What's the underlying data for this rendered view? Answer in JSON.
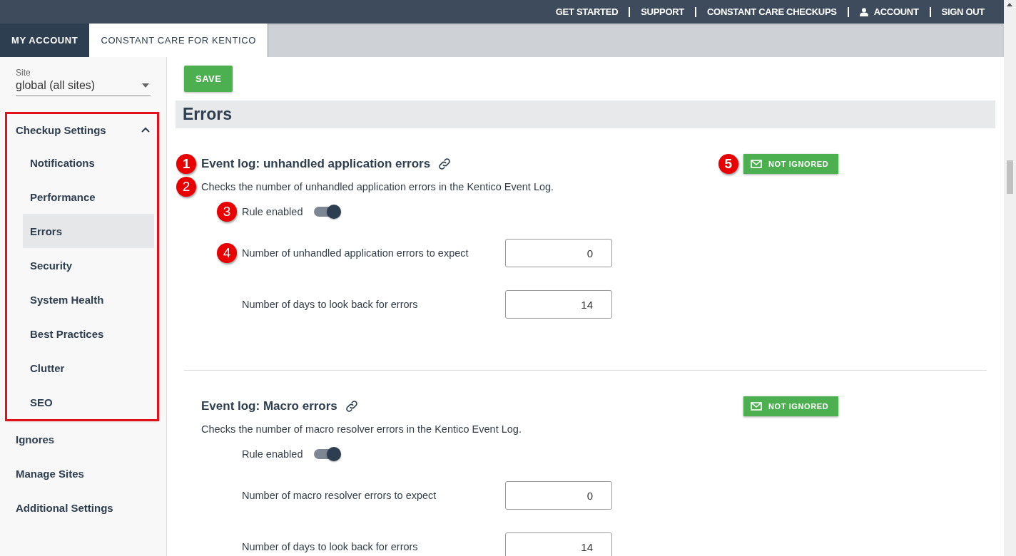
{
  "top_nav": [
    {
      "label": "GET STARTED",
      "kind": "plain"
    },
    {
      "label": "SUPPORT",
      "kind": "plain"
    },
    {
      "label": "CONSTANT CARE CHECKUPS",
      "kind": "plain"
    },
    {
      "label": "ACCOUNT",
      "kind": "user"
    },
    {
      "label": "SIGN OUT",
      "kind": "plain"
    }
  ],
  "tabs": [
    {
      "label": "MY ACCOUNT",
      "selected": false
    },
    {
      "label": "CONSTANT CARE FOR KENTICO",
      "selected": true
    }
  ],
  "sidebar": {
    "site_field": {
      "label": "Site",
      "value": "global (all sites)"
    },
    "items": [
      {
        "kind": "group",
        "label": "Checkup Settings",
        "expanded": true,
        "highlighted": true,
        "children": [
          {
            "label": "Notifications",
            "selected": false
          },
          {
            "label": "Performance",
            "selected": false
          },
          {
            "label": "Errors",
            "selected": true
          },
          {
            "label": "Security",
            "selected": false
          },
          {
            "label": "System Health",
            "selected": false
          },
          {
            "label": "Best Practices",
            "selected": false
          },
          {
            "label": "Clutter",
            "selected": false
          },
          {
            "label": "SEO",
            "selected": false
          }
        ]
      },
      {
        "kind": "link",
        "label": "Ignores"
      },
      {
        "kind": "link",
        "label": "Manage Sites"
      },
      {
        "kind": "link",
        "label": "Additional Settings"
      }
    ]
  },
  "main": {
    "save_button": "SAVE",
    "section_title": "Errors",
    "rules": [
      {
        "title": "Event log: unhandled application errors",
        "title_callout": "1",
        "description": "Checks the number of unhandled application errors in the Kentico Event Log.",
        "description_callout": "2",
        "status": "NOT IGNORED",
        "status_callout": "5",
        "toggle_label": "Rule enabled",
        "toggle_callout": "3",
        "enabled": true,
        "settings": [
          {
            "label": "Number of unhandled application errors to expect",
            "value": "0",
            "callout": "4"
          },
          {
            "label": "Number of days to look back for errors",
            "value": "14"
          }
        ]
      },
      {
        "title": "Event log: Macro errors",
        "description": "Checks the number of macro resolver errors in the Kentico Event Log.",
        "status": "NOT IGNORED",
        "toggle_label": "Rule enabled",
        "enabled": true,
        "settings": [
          {
            "label": "Number of macro resolver errors to expect",
            "value": "0"
          },
          {
            "label": "Number of days to look back for errors",
            "value": "14"
          }
        ]
      }
    ]
  }
}
